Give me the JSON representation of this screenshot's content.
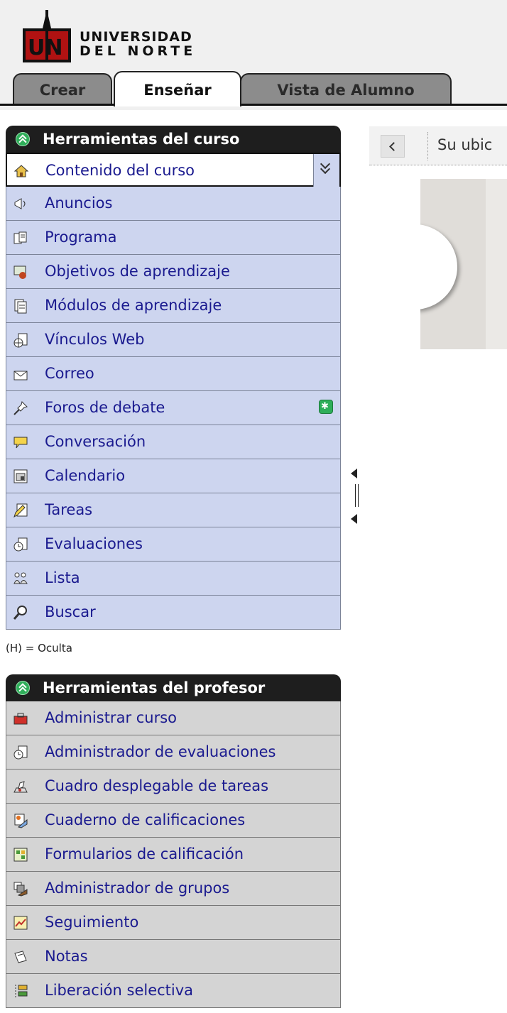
{
  "logo": {
    "line1": "UNIVERSIDAD",
    "line2": "DEL NORTE",
    "mark": "UN"
  },
  "tabs": [
    {
      "label": "Crear"
    },
    {
      "label": "Enseñar",
      "selected": true
    },
    {
      "label": "Vista de Alumno"
    }
  ],
  "course_tools": {
    "title": "Herramientas del curso",
    "items": [
      {
        "label": "Contenido del curso",
        "icon": "home-icon"
      },
      {
        "label": "Anuncios",
        "icon": "megaphone-icon"
      },
      {
        "label": "Programa",
        "icon": "syllabus-icon"
      },
      {
        "label": "Objetivos de aprendizaje",
        "icon": "apple-board-icon"
      },
      {
        "label": "Módulos de aprendizaje",
        "icon": "module-icon"
      },
      {
        "label": "Vínculos Web",
        "icon": "globe-doc-icon"
      },
      {
        "label": "Correo",
        "icon": "envelope-icon"
      },
      {
        "label": "Foros de debate",
        "icon": "pushpin-icon"
      },
      {
        "label": "Conversación",
        "icon": "chat-icon"
      },
      {
        "label": "Calendario",
        "icon": "calendar-icon"
      },
      {
        "label": "Tareas",
        "icon": "pencil-doc-icon"
      },
      {
        "label": "Evaluaciones",
        "icon": "clock-doc-icon"
      },
      {
        "label": "Lista",
        "icon": "people-icon"
      },
      {
        "label": "Buscar",
        "icon": "magnifier-icon"
      }
    ]
  },
  "hidden_note": "(H) = Oculta",
  "teacher_tools": {
    "title": "Herramientas del profesor",
    "items": [
      {
        "label": "Administrar curso",
        "icon": "toolbox-icon"
      },
      {
        "label": "Administrador de evaluaciones",
        "icon": "clock-doc-icon"
      },
      {
        "label": "Cuadro desplegable de tareas",
        "icon": "dropbox-icon"
      },
      {
        "label": "Cuaderno de calificaciones",
        "icon": "gradebook-icon"
      },
      {
        "label": "Formularios de calificación",
        "icon": "grid-form-icon"
      },
      {
        "label": "Administrador de grupos",
        "icon": "group-icon"
      },
      {
        "label": "Seguimiento",
        "icon": "chart-icon"
      },
      {
        "label": "Notas",
        "icon": "note-icon"
      },
      {
        "label": "Liberación selectiva",
        "icon": "release-icon"
      }
    ]
  },
  "breadcrumb": {
    "text": "Su ubic"
  },
  "colors": {
    "course_items": "#cdd5ef",
    "teacher_items": "#d4d4d4",
    "panel_header": "#1e1e1e",
    "link": "#1a1a8f"
  }
}
